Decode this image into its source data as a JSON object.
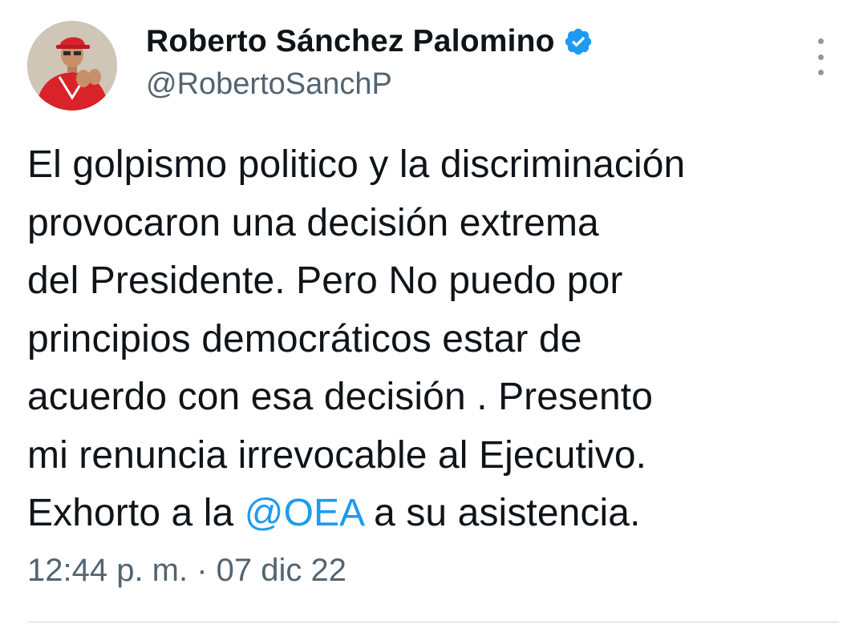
{
  "author": {
    "display_name": "Roberto Sánchez Palomino",
    "handle": "@RobertoSanchP",
    "verified_icon": "verified-badge-icon",
    "avatar_icon": "profile-avatar"
  },
  "tweet": {
    "lines": [
      {
        "text": "El golpismo politico y la discriminación"
      },
      {
        "text": "provocaron una decisión extrema"
      },
      {
        "text": "del Presidente. Pero No puedo por"
      },
      {
        "text": "principios democráticos estar de"
      },
      {
        "text": "acuerdo con esa decisión . Presento"
      },
      {
        "text": "mi renuncia irrevocable al Ejecutivo."
      },
      {
        "before": "Exhorto a la ",
        "mention": "@OEA",
        "after": " a su asistencia."
      }
    ]
  },
  "timestamp": "12:44 p. m. · 07 dic 22",
  "menu": {
    "icon": "more-vertical-icon"
  },
  "colors": {
    "accent": "#1d9bf0",
    "text": "#0f1419",
    "secondary": "#536471",
    "divider": "#cfd9de"
  }
}
